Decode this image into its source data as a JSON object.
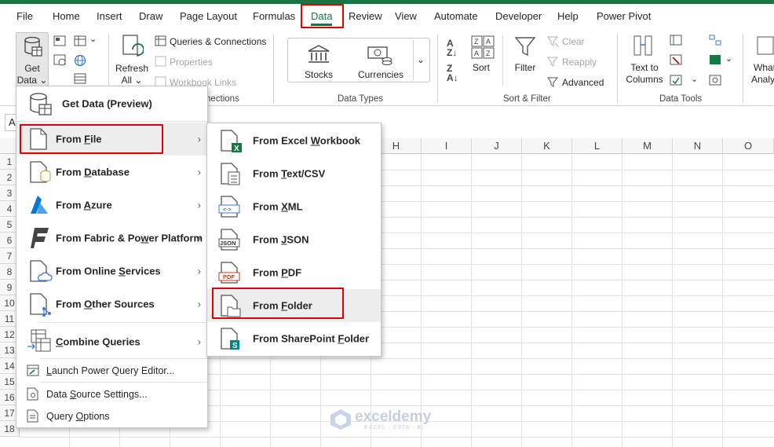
{
  "menu": {
    "items": [
      "File",
      "Home",
      "Insert",
      "Draw",
      "Page Layout",
      "Formulas",
      "Data",
      "Review",
      "View",
      "Automate",
      "Developer",
      "Help",
      "Power Pivot"
    ],
    "active": "Data"
  },
  "ribbon": {
    "get_data_line1": "Get",
    "get_data_line2": "Data",
    "refresh_line1": "Refresh",
    "refresh_line2": "All",
    "queries_connections": "Queries & Connections",
    "properties": "Properties",
    "workbook_links": "Workbook Links",
    "connections_group_tail": "nections",
    "stocks": "Stocks",
    "currencies": "Currencies",
    "data_types_group": "Data Types",
    "sort": "Sort",
    "filter": "Filter",
    "clear": "Clear",
    "reapply": "Reapply",
    "advanced": "Advanced",
    "sort_filter_group": "Sort & Filter",
    "text_to_columns_line1": "Text to",
    "text_to_columns_line2": "Columns",
    "data_tools_group": "Data Tools",
    "whatif_line1": "What",
    "whatif_line2": "Analy"
  },
  "grid": {
    "columns": [
      "H",
      "I",
      "J",
      "K",
      "L",
      "M",
      "N",
      "O"
    ],
    "rows": [
      "1",
      "2",
      "3",
      "4",
      "5",
      "6",
      "7",
      "8",
      "9",
      "10",
      "11",
      "12",
      "13",
      "14",
      "15",
      "16",
      "17",
      "18"
    ],
    "namebox_fragment": "A"
  },
  "get_data_menu": {
    "header": "Get Data (Preview)",
    "items": [
      {
        "pre": "From ",
        "u": "F",
        "post": "ile"
      },
      {
        "pre": "From ",
        "u": "D",
        "post": "atabase"
      },
      {
        "pre": "From ",
        "u": "A",
        "post": "zure"
      },
      {
        "pre": "From Fabric & Po",
        "u": "w",
        "post": "er Platform"
      },
      {
        "pre": "From Online ",
        "u": "S",
        "post": "ervices"
      },
      {
        "pre": "From ",
        "u": "O",
        "post": "ther Sources"
      },
      {
        "pre": "",
        "u": "C",
        "post": "ombine Queries"
      }
    ],
    "footer": [
      {
        "pre": "",
        "u": "L",
        "post": "aunch Power Query Editor..."
      },
      {
        "pre": "Data ",
        "u": "S",
        "post": "ource Settings..."
      },
      {
        "pre": "Query ",
        "u": "O",
        "post": "ptions"
      }
    ]
  },
  "from_file_menu": {
    "items": [
      {
        "pre": "From Excel ",
        "u": "W",
        "post": "orkbook",
        "icon_badge": "X"
      },
      {
        "pre": "From ",
        "u": "T",
        "post": "ext/CSV",
        "icon_badge": ""
      },
      {
        "pre": "From ",
        "u": "X",
        "post": "ML",
        "icon_badge": "XML"
      },
      {
        "pre": "From ",
        "u": "J",
        "post": "SON",
        "icon_badge": "JSON"
      },
      {
        "pre": "From ",
        "u": "P",
        "post": "DF",
        "icon_badge": "PDF"
      },
      {
        "pre": "From ",
        "u": "F",
        "post": "older",
        "icon_badge": ""
      },
      {
        "pre": "From SharePoint ",
        "u": "F",
        "post": "older",
        "icon_badge": "S"
      }
    ]
  },
  "watermark": {
    "brand": "exceldemy",
    "tagline": "EXCEL · DATA · BI"
  },
  "colors": {
    "accent": "#1e7145",
    "highlight_box": "#e00000",
    "excel_green": "#107c41",
    "sharepoint": "#038387",
    "azure": "#0078d4",
    "pdf": "#c43e1c"
  }
}
